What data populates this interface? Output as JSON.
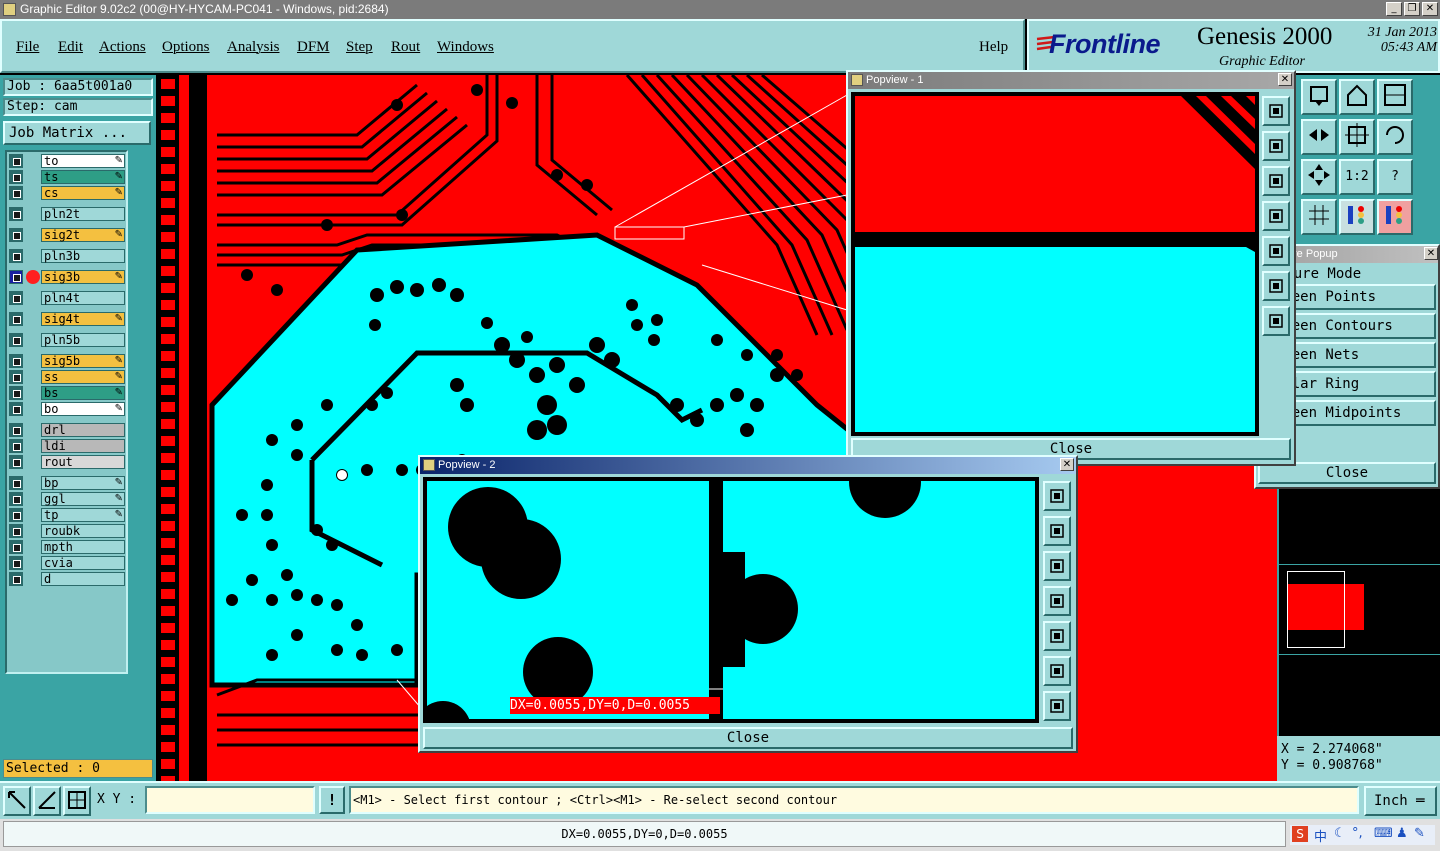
{
  "window": {
    "title": "Graphic Editor 9.02c2 (00@HY-HYCAM-PC041 - Windows, pid:2684)",
    "min_label": "_",
    "max_label": "❐",
    "close_label": "✕"
  },
  "menu": [
    "File",
    "Edit",
    "Actions",
    "Options",
    "Analysis",
    "DFM",
    "Step",
    "Rout",
    "Windows"
  ],
  "help": "Help",
  "brand": {
    "logo": "Frontline",
    "product": "Genesis 2000",
    "subtitle": "Graphic Editor",
    "date": "31 Jan 2013",
    "time": "05:43 AM"
  },
  "job": {
    "job_label": "Job : 6aa5t001a0",
    "step_label": "Step: cam",
    "matrix_button": "Job Matrix ..."
  },
  "layers": [
    {
      "name": "to",
      "color": "#ffffff",
      "pen": true
    },
    {
      "name": "ts",
      "color": "#2e9e86",
      "pen": true
    },
    {
      "name": "cs",
      "color": "#f4c040",
      "pen": true
    },
    {
      "name": "pln2t",
      "color": "#9fd8d8",
      "pen": false
    },
    {
      "name": "sig2t",
      "color": "#f4c040",
      "pen": true
    },
    {
      "name": "pln3b",
      "color": "#9fd8d8",
      "pen": false
    },
    {
      "name": "sig3b",
      "color": "#f4c040",
      "pen": true
    },
    {
      "name": "pln4t",
      "color": "#9fd8d8",
      "pen": false
    },
    {
      "name": "sig4t",
      "color": "#f4c040",
      "pen": true
    },
    {
      "name": "pln5b",
      "color": "#9fd8d8",
      "pen": false
    },
    {
      "name": "sig5b",
      "color": "#f4c040",
      "pen": true
    },
    {
      "name": "ss",
      "color": "#f4c040",
      "pen": true
    },
    {
      "name": "bs",
      "color": "#2e9e86",
      "pen": true
    },
    {
      "name": "bo",
      "color": "#ffffff",
      "pen": true
    },
    {
      "name": "drl",
      "color": "#b8b8b8",
      "pen": false
    },
    {
      "name": "ldi",
      "color": "#b8b8b8",
      "pen": false
    },
    {
      "name": "rout",
      "color": "#d8d8d8",
      "pen": false
    },
    {
      "name": "bp",
      "color": "#9fd8d8",
      "pen": true
    },
    {
      "name": "ggl",
      "color": "#9fd8d8",
      "pen": true
    },
    {
      "name": "tp",
      "color": "#9fd8d8",
      "pen": true
    },
    {
      "name": "roubk",
      "color": "#9fd8d8",
      "pen": false
    },
    {
      "name": "mpth",
      "color": "#9fd8d8",
      "pen": false
    },
    {
      "name": "cvia",
      "color": "#9fd8d8",
      "pen": false
    },
    {
      "name": "d",
      "color": "#9fd8d8",
      "pen": false
    }
  ],
  "selected": "Selected : 0",
  "popview1": {
    "title": "Popview - 1",
    "close": "Close"
  },
  "popview2": {
    "title": "Popview - 2",
    "close": "Close",
    "measure_readout": "DX=0.0055,DY=0,D=0.0055"
  },
  "measure_popup": {
    "title": "Measure Popup",
    "header": "Measure Mode",
    "items": [
      "Between Points",
      "Between Contours",
      "Between Nets",
      "Annular Ring",
      "Between Midpoints"
    ],
    "close": "Close"
  },
  "coords": {
    "x": "X = 2.274068\"",
    "y": "Y = 0.908768\""
  },
  "bottom": {
    "xy_label": "X Y :",
    "xy_value": "",
    "prompt": "<M1> - Select first contour ; <Ctrl><M1> - Re-select second contour",
    "units": "Inch"
  },
  "status": "DX=0.0055,DY=0,D=0.0055",
  "tool_icons_right": [
    "1:2",
    "?"
  ]
}
